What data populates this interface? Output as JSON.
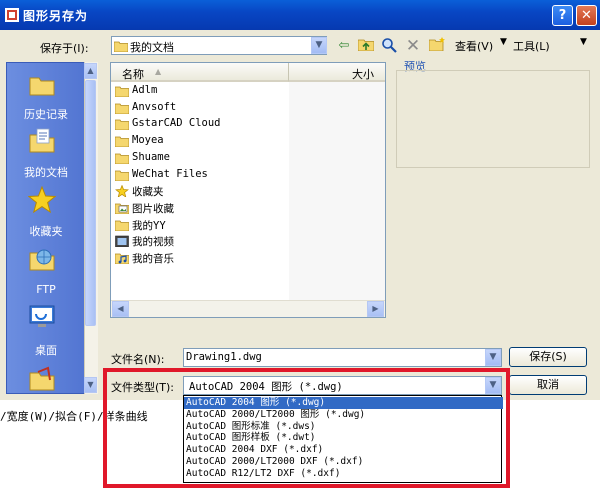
{
  "window": {
    "title": "图形另存为",
    "help": "?",
    "close": "✕"
  },
  "toolbar": {
    "savein_label": "保存于(I):",
    "savein_value": "我的文档",
    "view_menu": "查看(V)",
    "tools_menu": "工具(L)"
  },
  "places": [
    {
      "label": "历史记录",
      "icon": "history-icon"
    },
    {
      "label": "我的文档",
      "icon": "my-documents-icon"
    },
    {
      "label": "收藏夹",
      "icon": "favorites-star-icon"
    },
    {
      "label": "FTP",
      "icon": "ftp-icon"
    },
    {
      "label": "桌面",
      "icon": "desktop-icon"
    }
  ],
  "filelist": {
    "col_name": "名称",
    "col_size": "大小",
    "items": [
      {
        "label": "Adlm",
        "icon": "folder-icon"
      },
      {
        "label": "Anvsoft",
        "icon": "folder-icon"
      },
      {
        "label": "GstarCAD Cloud",
        "icon": "folder-icon"
      },
      {
        "label": "Moyea",
        "icon": "folder-icon"
      },
      {
        "label": "Shuame",
        "icon": "folder-icon"
      },
      {
        "label": "WeChat Files",
        "icon": "folder-icon"
      },
      {
        "label": "收藏夹",
        "icon": "favorites-folder-icon"
      },
      {
        "label": "图片收藏",
        "icon": "pictures-folder-icon"
      },
      {
        "label": "我的YY",
        "icon": "folder-icon"
      },
      {
        "label": "我的视频",
        "icon": "video-folder-icon"
      },
      {
        "label": "我的音乐",
        "icon": "music-folder-icon"
      }
    ]
  },
  "preview": {
    "label": "预览"
  },
  "filename": {
    "label": "文件名(N):",
    "value": "Drawing1.dwg"
  },
  "filetype": {
    "label": "文件类型(T):",
    "value": "AutoCAD 2004 图形 (*.dwg)",
    "options": [
      "AutoCAD 2004 图形 (*.dwg)",
      "AutoCAD 2000/LT2000 图形 (*.dwg)",
      "AutoCAD 图形标准 (*.dws)",
      "AutoCAD 图形样板 (*.dwt)",
      "AutoCAD 2004 DXF (*.dxf)",
      "AutoCAD 2000/LT2000 DXF (*.dxf)",
      "AutoCAD R12/LT2 DXF (*.dxf)"
    ]
  },
  "buttons": {
    "save": "保存(S)",
    "cancel": "取消"
  },
  "command_line": "/宽度(W)/拟合(F)/样条曲线"
}
